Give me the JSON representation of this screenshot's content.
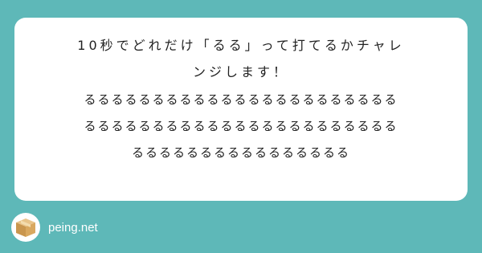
{
  "card": {
    "question_line1": "10秒でどれだけ「るる」って打てるかチャレ",
    "question_line2": "ンジします！",
    "answer_line1": "るるるるるるるるるるるるるるるるるるるるるるる",
    "answer_line2": "るるるるるるるるるるるるるるるるるるるるるるる",
    "answer_line3": "るるるるるるるるるるるるるるるる"
  },
  "footer": {
    "logo_icon": "cardboard-box-icon",
    "site_name": "peing.net"
  },
  "colors": {
    "background": "#5eb8b8",
    "card": "#ffffff",
    "text": "#222222",
    "footer_text": "#ffffff"
  }
}
